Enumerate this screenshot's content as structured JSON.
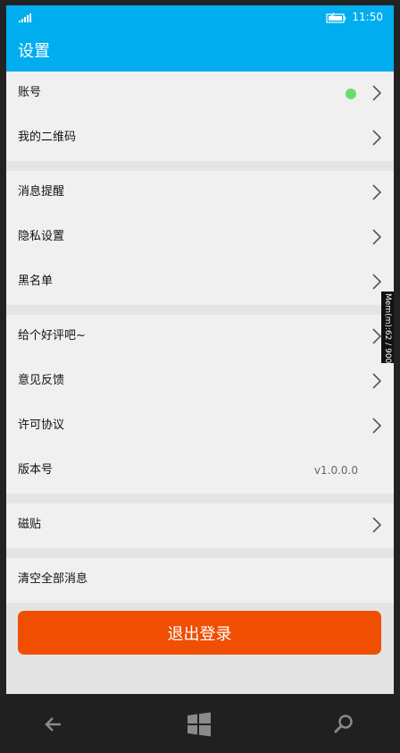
{
  "status": {
    "time": "11:50"
  },
  "header": {
    "title": "设置"
  },
  "groups": [
    {
      "items": [
        {
          "label": "账号",
          "status_dot": "#6ddb6b",
          "chevron": true
        },
        {
          "label": "我的二维码",
          "chevron": true
        }
      ]
    },
    {
      "items": [
        {
          "label": "消息提醒",
          "chevron": true
        },
        {
          "label": "隐私设置",
          "chevron": true
        },
        {
          "label": "黑名单",
          "chevron": true
        }
      ]
    },
    {
      "items": [
        {
          "label": "给个好评吧~",
          "chevron": true
        },
        {
          "label": "意见反馈",
          "chevron": true
        },
        {
          "label": "许可协议",
          "chevron": true
        },
        {
          "label": "版本号",
          "value": "v1.0.0.0"
        }
      ]
    },
    {
      "items": [
        {
          "label": "磁贴",
          "chevron": true
        }
      ]
    },
    {
      "items": [
        {
          "label": "清空全部消息"
        }
      ]
    }
  ],
  "logout": {
    "label": "退出登录"
  },
  "debug": {
    "memory": "Mem(m):62 / 900"
  },
  "colors": {
    "accent": "#00adef",
    "logout": "#f04e00",
    "chevron": "#555555"
  },
  "icons": {
    "back": "back-arrow-icon",
    "start": "windows-logo-icon",
    "search": "search-icon"
  }
}
